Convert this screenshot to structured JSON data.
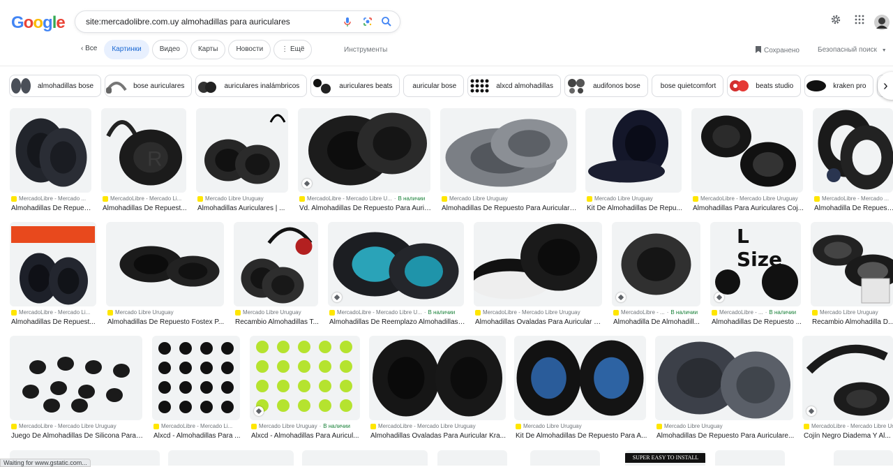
{
  "search": {
    "query": "site:mercadolibre.com.uy almohadillas para auriculares"
  },
  "tabs": [
    {
      "label": "Все",
      "active": false
    },
    {
      "label": "Картинки",
      "active": true
    },
    {
      "label": "Видео",
      "active": false
    },
    {
      "label": "Карты",
      "active": false
    },
    {
      "label": "Новости",
      "active": false
    },
    {
      "label": "Ещё",
      "active": false
    }
  ],
  "toolbar": {
    "tools": "Инструменты",
    "saved": "Сохранено",
    "safesearch": "Безопасный поиск"
  },
  "chips": [
    "almohadillas bose",
    "bose auriculares",
    "auriculares inalámbricos",
    "auriculares beats",
    "auricular bose",
    "alxcd almohadillas",
    "audifonos bose",
    "bose quietcomfort",
    "beats studio",
    "kraken pro"
  ],
  "results": [
    {
      "source": "MercadoLibre - Mercado ...",
      "stock": "",
      "title": "Almohadillas De Repuesto ..."
    },
    {
      "source": "MercadoLibre - Mercado Li...",
      "stock": "",
      "title": "Almohadillas De Repuest..."
    },
    {
      "source": "Mercado Libre Uruguay",
      "stock": "",
      "title": "Almohadillas Auriculares | ..."
    },
    {
      "source": "MercadoLibre - Mercado Libre U...",
      "stock": "В наличии",
      "title": "Vd. Almohadillas De Repuesto Para Auric..."
    },
    {
      "source": "Mercado Libre Uruguay",
      "stock": "",
      "title": "Almohadillas De Repuesto Para Auriculares..."
    },
    {
      "source": "Mercado Libre Uruguay",
      "stock": "",
      "title": "Kit De Almohadillas De Repu..."
    },
    {
      "source": "MercadoLibre - Mercado Libre Uruguay",
      "stock": "",
      "title": "Almohadillas Para Auriculares Coj..."
    },
    {
      "source": "MercadoLibre - Mercado ...",
      "stock": "",
      "title": "Almohadilla De Repuest..."
    },
    {
      "source": "MercadoLibre - Mercado Li...",
      "stock": "",
      "title": "Almohadillas De Repuest..."
    },
    {
      "source": "Mercado Libre Uruguay",
      "stock": "",
      "title": "Almohadillas De Repuesto Fostex P..."
    },
    {
      "source": "Mercado Libre Uruguay",
      "stock": "",
      "title": "Recambio Almohadillas T..."
    },
    {
      "source": "MercadoLibre - Mercado Libre U...",
      "stock": "В наличии",
      "title": "Almohadillas De Reemplazo Almohadillas ..."
    },
    {
      "source": "MercadoLibre - Mercado Libre Uruguay",
      "stock": "",
      "title": "Almohadillas Ovaladas Para Auricular K..."
    },
    {
      "source": "MercadoLibre - ...",
      "stock": "В наличии",
      "title": "Almohadilla De Almohadill..."
    },
    {
      "source": "MercadoLibre - ...",
      "stock": "В наличии",
      "title": "Almohadillas De Repuesto ..."
    },
    {
      "source": "Mercado Libre Uruguay",
      "stock": "",
      "title": "Recambio Almohadilla D..."
    },
    {
      "source": "MercadoLibre - Mercado Libre Uruguay",
      "stock": "",
      "title": "Juego De Almohadillas De Silicona Para ..."
    },
    {
      "source": "MercadoLibre - Mercado Li...",
      "stock": "",
      "title": "Alxcd - Almohadillas Para ..."
    },
    {
      "source": "Mercado Libre Uruguay",
      "stock": "В наличии",
      "title": "Alxcd - Almohadillas Para Auricul..."
    },
    {
      "source": "MercadoLibre - Mercado Libre Uruguay",
      "stock": "",
      "title": "Almohadillas Ovaladas Para Auricular Kra..."
    },
    {
      "source": "Mercado Libre Uruguay",
      "stock": "",
      "title": "Kit De Almohadillas De Repuesto Para A..."
    },
    {
      "source": "Mercado Libre Uruguay",
      "stock": "",
      "title": "Almohadillas De Repuesto Para Auriculare..."
    },
    {
      "source": "MercadoLibre - Mercado Libre Uru...",
      "stock": "В наличии",
      "title": "Cojín Negro Diadema Y Al..."
    }
  ],
  "image_text": {
    "l_size": "L Size",
    "super_easy": "SUPER EASY TO INSTALL"
  },
  "status_bar": "Waiting for www.gstatic.com..."
}
